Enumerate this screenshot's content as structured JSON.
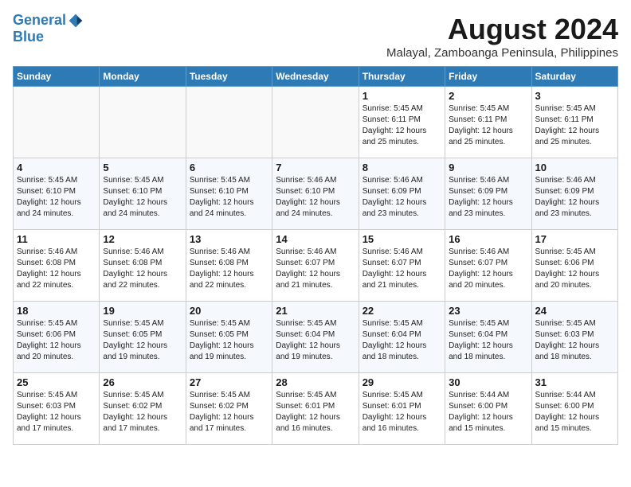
{
  "logo": {
    "line1": "General",
    "line2": "Blue"
  },
  "title": "August 2024",
  "subtitle": "Malayal, Zamboanga Peninsula, Philippines",
  "days_header": [
    "Sunday",
    "Monday",
    "Tuesday",
    "Wednesday",
    "Thursday",
    "Friday",
    "Saturday"
  ],
  "weeks": [
    [
      {
        "day": "",
        "info": ""
      },
      {
        "day": "",
        "info": ""
      },
      {
        "day": "",
        "info": ""
      },
      {
        "day": "",
        "info": ""
      },
      {
        "day": "1",
        "info": "Sunrise: 5:45 AM\nSunset: 6:11 PM\nDaylight: 12 hours\nand 25 minutes."
      },
      {
        "day": "2",
        "info": "Sunrise: 5:45 AM\nSunset: 6:11 PM\nDaylight: 12 hours\nand 25 minutes."
      },
      {
        "day": "3",
        "info": "Sunrise: 5:45 AM\nSunset: 6:11 PM\nDaylight: 12 hours\nand 25 minutes."
      }
    ],
    [
      {
        "day": "4",
        "info": "Sunrise: 5:45 AM\nSunset: 6:10 PM\nDaylight: 12 hours\nand 24 minutes."
      },
      {
        "day": "5",
        "info": "Sunrise: 5:45 AM\nSunset: 6:10 PM\nDaylight: 12 hours\nand 24 minutes."
      },
      {
        "day": "6",
        "info": "Sunrise: 5:45 AM\nSunset: 6:10 PM\nDaylight: 12 hours\nand 24 minutes."
      },
      {
        "day": "7",
        "info": "Sunrise: 5:46 AM\nSunset: 6:10 PM\nDaylight: 12 hours\nand 24 minutes."
      },
      {
        "day": "8",
        "info": "Sunrise: 5:46 AM\nSunset: 6:09 PM\nDaylight: 12 hours\nand 23 minutes."
      },
      {
        "day": "9",
        "info": "Sunrise: 5:46 AM\nSunset: 6:09 PM\nDaylight: 12 hours\nand 23 minutes."
      },
      {
        "day": "10",
        "info": "Sunrise: 5:46 AM\nSunset: 6:09 PM\nDaylight: 12 hours\nand 23 minutes."
      }
    ],
    [
      {
        "day": "11",
        "info": "Sunrise: 5:46 AM\nSunset: 6:08 PM\nDaylight: 12 hours\nand 22 minutes."
      },
      {
        "day": "12",
        "info": "Sunrise: 5:46 AM\nSunset: 6:08 PM\nDaylight: 12 hours\nand 22 minutes."
      },
      {
        "day": "13",
        "info": "Sunrise: 5:46 AM\nSunset: 6:08 PM\nDaylight: 12 hours\nand 22 minutes."
      },
      {
        "day": "14",
        "info": "Sunrise: 5:46 AM\nSunset: 6:07 PM\nDaylight: 12 hours\nand 21 minutes."
      },
      {
        "day": "15",
        "info": "Sunrise: 5:46 AM\nSunset: 6:07 PM\nDaylight: 12 hours\nand 21 minutes."
      },
      {
        "day": "16",
        "info": "Sunrise: 5:46 AM\nSunset: 6:07 PM\nDaylight: 12 hours\nand 20 minutes."
      },
      {
        "day": "17",
        "info": "Sunrise: 5:45 AM\nSunset: 6:06 PM\nDaylight: 12 hours\nand 20 minutes."
      }
    ],
    [
      {
        "day": "18",
        "info": "Sunrise: 5:45 AM\nSunset: 6:06 PM\nDaylight: 12 hours\nand 20 minutes."
      },
      {
        "day": "19",
        "info": "Sunrise: 5:45 AM\nSunset: 6:05 PM\nDaylight: 12 hours\nand 19 minutes."
      },
      {
        "day": "20",
        "info": "Sunrise: 5:45 AM\nSunset: 6:05 PM\nDaylight: 12 hours\nand 19 minutes."
      },
      {
        "day": "21",
        "info": "Sunrise: 5:45 AM\nSunset: 6:04 PM\nDaylight: 12 hours\nand 19 minutes."
      },
      {
        "day": "22",
        "info": "Sunrise: 5:45 AM\nSunset: 6:04 PM\nDaylight: 12 hours\nand 18 minutes."
      },
      {
        "day": "23",
        "info": "Sunrise: 5:45 AM\nSunset: 6:04 PM\nDaylight: 12 hours\nand 18 minutes."
      },
      {
        "day": "24",
        "info": "Sunrise: 5:45 AM\nSunset: 6:03 PM\nDaylight: 12 hours\nand 18 minutes."
      }
    ],
    [
      {
        "day": "25",
        "info": "Sunrise: 5:45 AM\nSunset: 6:03 PM\nDaylight: 12 hours\nand 17 minutes."
      },
      {
        "day": "26",
        "info": "Sunrise: 5:45 AM\nSunset: 6:02 PM\nDaylight: 12 hours\nand 17 minutes."
      },
      {
        "day": "27",
        "info": "Sunrise: 5:45 AM\nSunset: 6:02 PM\nDaylight: 12 hours\nand 17 minutes."
      },
      {
        "day": "28",
        "info": "Sunrise: 5:45 AM\nSunset: 6:01 PM\nDaylight: 12 hours\nand 16 minutes."
      },
      {
        "day": "29",
        "info": "Sunrise: 5:45 AM\nSunset: 6:01 PM\nDaylight: 12 hours\nand 16 minutes."
      },
      {
        "day": "30",
        "info": "Sunrise: 5:44 AM\nSunset: 6:00 PM\nDaylight: 12 hours\nand 15 minutes."
      },
      {
        "day": "31",
        "info": "Sunrise: 5:44 AM\nSunset: 6:00 PM\nDaylight: 12 hours\nand 15 minutes."
      }
    ]
  ]
}
